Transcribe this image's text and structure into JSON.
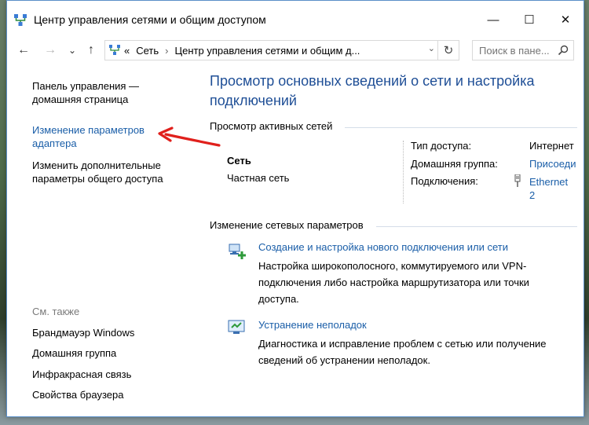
{
  "window": {
    "title": "Центр управления сетями и общим доступом",
    "minimize_glyph": "—",
    "maximize_glyph": "☐",
    "close_glyph": "✕"
  },
  "address": {
    "back_glyph": "←",
    "forward_glyph": "→",
    "recent_glyph": "⌄",
    "up_glyph": "↑",
    "overflow": "«",
    "crumbs": [
      "Сеть",
      "Центр управления сетями и общим д..."
    ],
    "separator": "›",
    "dropdown_glyph": "⌄",
    "refresh_glyph": "↻",
    "search_placeholder": "Поиск в пане..."
  },
  "sidebar": {
    "home_line1": "Панель управления —",
    "home_line2": "домашняя страница",
    "adapter_line1": "Изменение параметров",
    "adapter_line2": "адаптера",
    "sharing_line1": "Изменить дополнительные",
    "sharing_line2": "параметры общего доступа",
    "see_also": "См. также",
    "links": [
      "Брандмауэр Windows",
      "Домашняя группа",
      "Инфракрасная связь",
      "Свойства браузера"
    ]
  },
  "main": {
    "heading_line1": "Просмотр основных сведений о сети и настройка",
    "heading_line2": "подключений",
    "active_title": "Просмотр активных сетей",
    "network_name": "Сеть",
    "network_type": "Частная сеть",
    "access_label": "Тип доступа:",
    "access_value": "Интернет",
    "homegroup_label": "Домашняя группа:",
    "homegroup_value": "Присоеди",
    "connections_label": "Подключения:",
    "connections_value_line1": "Ethernet",
    "connections_value_line2": "2",
    "change_title": "Изменение сетевых параметров",
    "task1_link": "Создание и настройка нового подключения или сети",
    "task1_desc": "Настройка широкополосного, коммутируемого или VPN-подключения либо настройка маршрутизатора или точки доступа.",
    "task2_link": "Устранение неполадок",
    "task2_desc": "Диагностика и исправление проблем с сетью или получение сведений об устранении неполадок."
  },
  "colors": {
    "link": "#1a5ea8",
    "heading": "#1e4e96",
    "annotation_arrow": "#e0201c"
  }
}
